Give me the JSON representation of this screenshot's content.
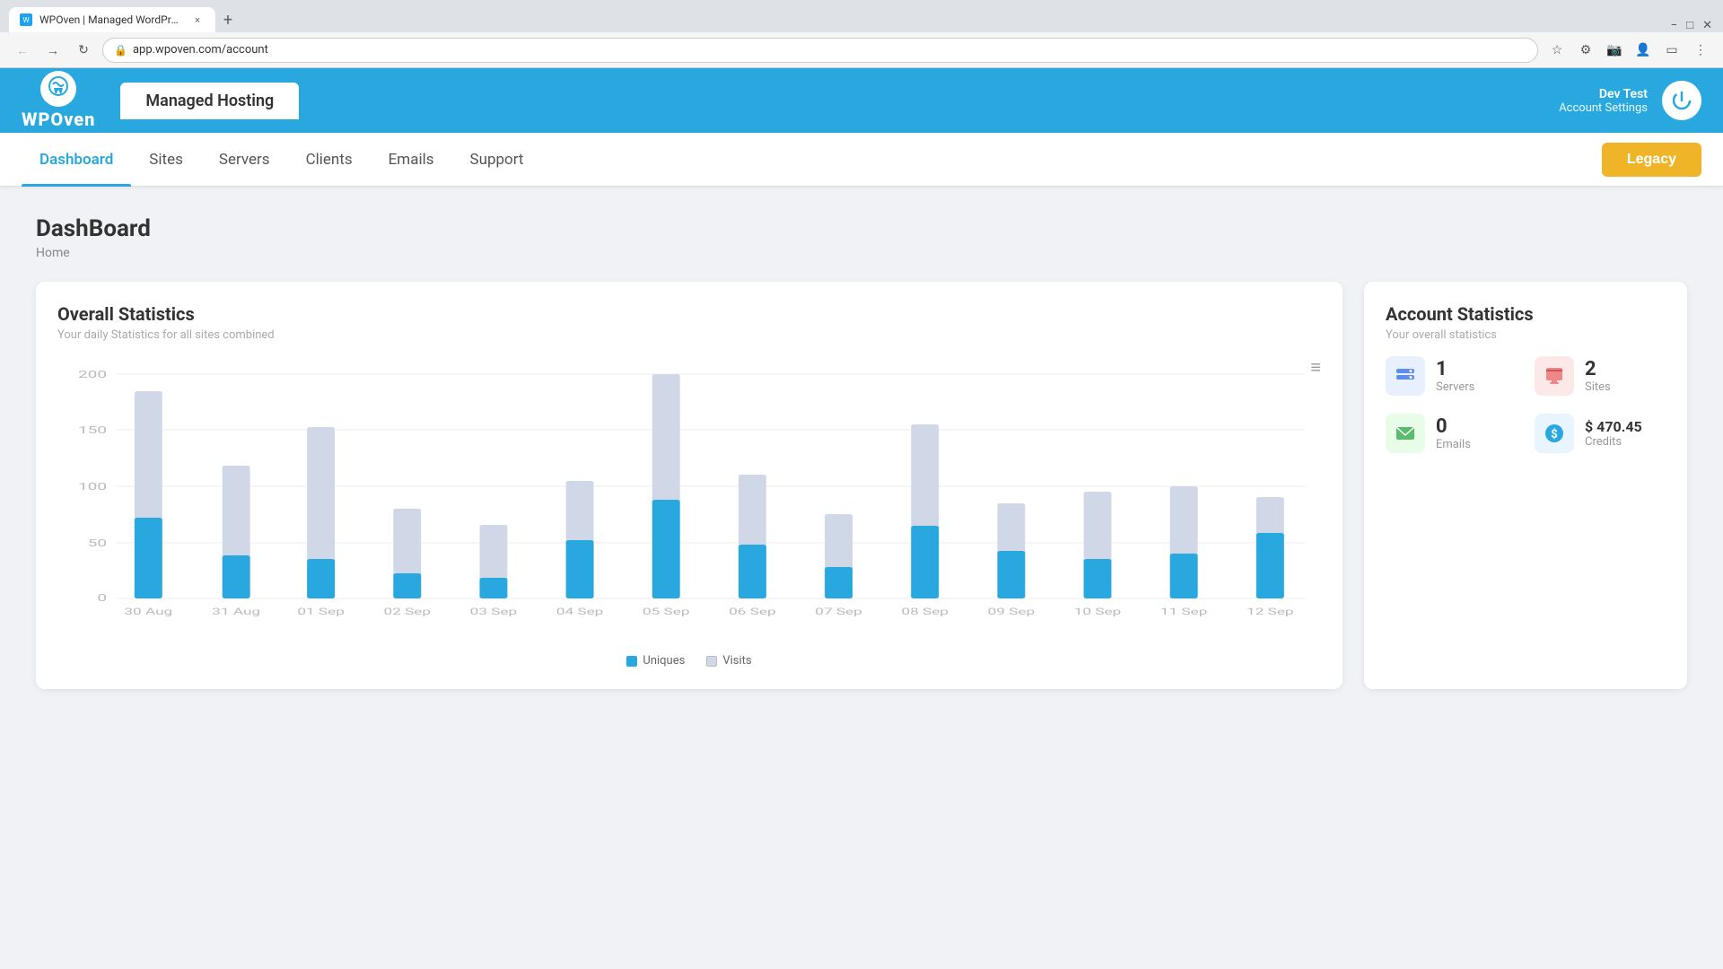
{
  "browser": {
    "tab_title": "WPOven | Managed WordPress",
    "url": "app.wpoven.com/account",
    "tab_close": "×",
    "tab_new": "+"
  },
  "header": {
    "logo": "WPOven",
    "nav_tab": "Managed Hosting",
    "user_name": "Dev Test",
    "account_settings": "Account Settings"
  },
  "nav": {
    "items": [
      {
        "label": "Dashboard",
        "active": true
      },
      {
        "label": "Sites",
        "active": false
      },
      {
        "label": "Servers",
        "active": false
      },
      {
        "label": "Clients",
        "active": false
      },
      {
        "label": "Emails",
        "active": false
      },
      {
        "label": "Support",
        "active": false
      }
    ],
    "legacy_label": "Legacy"
  },
  "page": {
    "title": "DashBoard",
    "breadcrumb": "Home"
  },
  "overall_stats": {
    "title": "Overall Statistics",
    "subtitle": "Your daily Statistics for all sites combined",
    "menu_icon": "≡",
    "y_labels": [
      "200",
      "150",
      "100",
      "50",
      "0"
    ],
    "bars": [
      {
        "date": "30 Aug",
        "visits": 185,
        "uniques": 72
      },
      {
        "date": "31 Aug",
        "visits": 118,
        "uniques": 38
      },
      {
        "date": "01 Sep",
        "visits": 153,
        "uniques": 35
      },
      {
        "date": "02 Sep",
        "visits": 80,
        "uniques": 22
      },
      {
        "date": "03 Sep",
        "visits": 65,
        "uniques": 18
      },
      {
        "date": "04 Sep",
        "visits": 105,
        "uniques": 52
      },
      {
        "date": "05 Sep",
        "visits": 200,
        "uniques": 88
      },
      {
        "date": "06 Sep",
        "visits": 110,
        "uniques": 48
      },
      {
        "date": "07 Sep",
        "visits": 75,
        "uniques": 28
      },
      {
        "date": "08 Sep",
        "visits": 155,
        "uniques": 65
      },
      {
        "date": "09 Sep",
        "visits": 85,
        "uniques": 42
      },
      {
        "date": "10 Sep",
        "visits": 95,
        "uniques": 35
      },
      {
        "date": "11 Sep",
        "visits": 100,
        "uniques": 40
      },
      {
        "date": "12 Sep",
        "visits": 90,
        "uniques": 58
      }
    ],
    "legend_uniques": "Uniques",
    "legend_visits": "Visits"
  },
  "account_stats": {
    "title": "Account Statistics",
    "subtitle": "Your overall statistics",
    "servers_value": "1",
    "servers_label": "Servers",
    "sites_value": "2",
    "sites_label": "Sites",
    "emails_value": "0",
    "emails_label": "Emails",
    "credits_value": "$ 470.45",
    "credits_label": "Credits"
  },
  "colors": {
    "primary": "#29a8e0",
    "accent": "#f0b429",
    "bar_visits": "#d0d8e8",
    "bar_uniques": "#29a8e0"
  }
}
